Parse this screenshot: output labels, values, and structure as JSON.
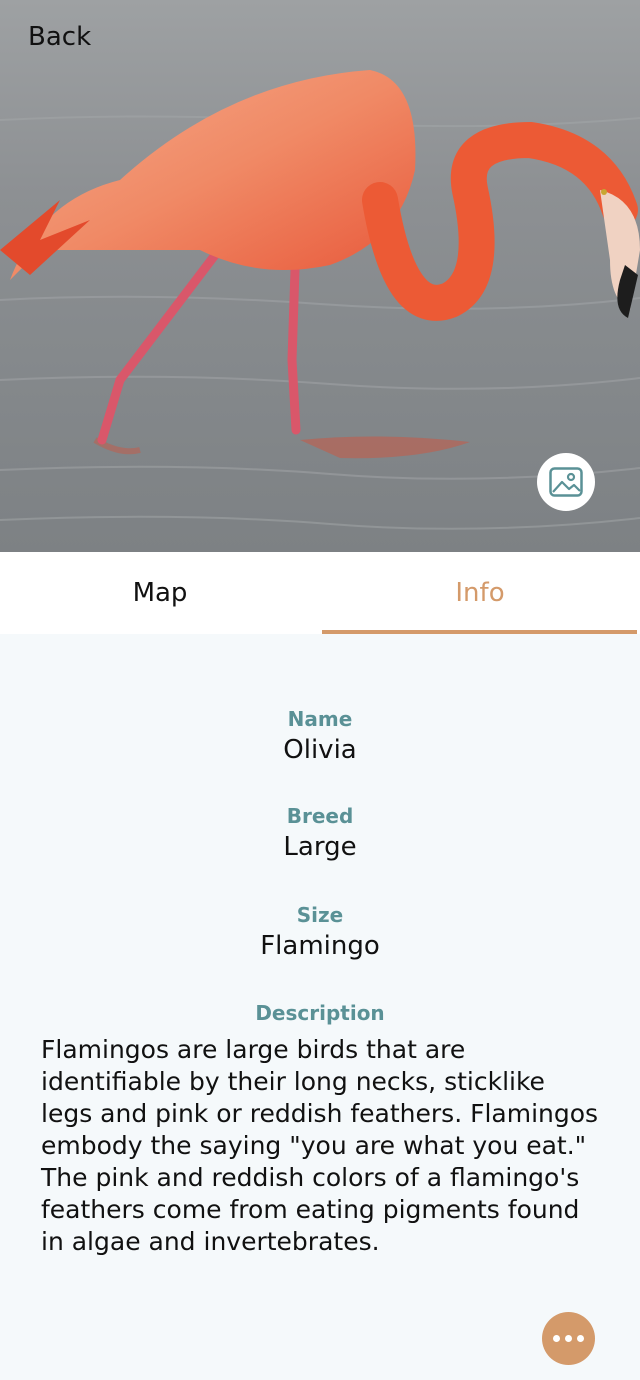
{
  "header": {
    "back_label": "Back"
  },
  "hero": {
    "image_icon": "image-icon"
  },
  "tabs": [
    {
      "label": "Map",
      "active": false
    },
    {
      "label": "Info",
      "active": true
    }
  ],
  "info": {
    "name_label": "Name",
    "name_value": "Olivia",
    "breed_label": "Breed",
    "breed_value": "Large",
    "size_label": "Size",
    "size_value": "Flamingo",
    "description_label": "Description",
    "description_value": "Flamingos are large birds that are identifiable by their long necks, sticklike legs and pink or reddish feathers. Flamingos embody the saying \"you are what you eat.\" The pink and reddish colors of a flamingo's feathers come from eating pigments found in algae and invertebrates."
  },
  "fab": {
    "icon": "more-horizontal-icon"
  },
  "colors": {
    "accent": "#d49a6a",
    "label": "#5a9196",
    "background": "#f5f9fb"
  }
}
